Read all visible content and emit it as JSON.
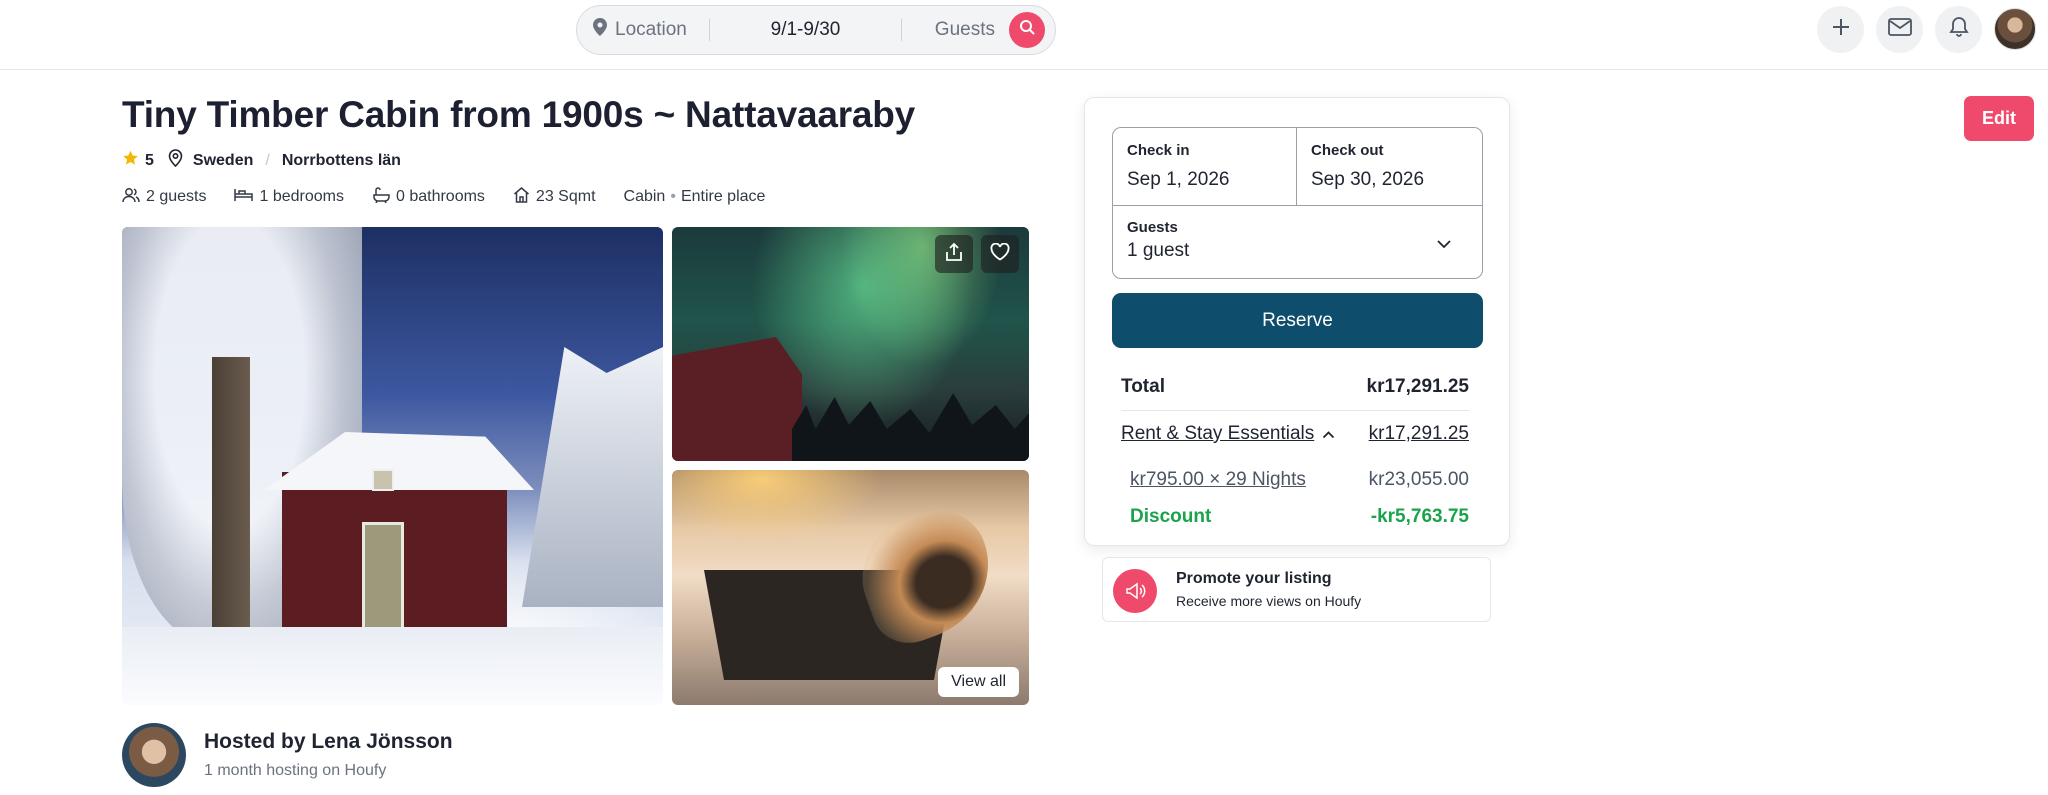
{
  "search": {
    "location_placeholder": "Location",
    "dates": "9/1-9/30",
    "guests_placeholder": "Guests"
  },
  "listing": {
    "title": "Tiny Timber Cabin from 1900s ~ Nattavaaraby",
    "rating": "5",
    "country": "Sweden",
    "region": "Norrbottens län",
    "guests": "2 guests",
    "bedrooms": "1 bedrooms",
    "bathrooms": "0 bathrooms",
    "size": "23 Sqmt",
    "type": "Cabin",
    "place": "Entire place"
  },
  "photos": {
    "view_all_label": "View all"
  },
  "host": {
    "name": "Hosted by Lena Jönsson",
    "subtitle": "1 month hosting on Houfy"
  },
  "booking": {
    "checkin_label": "Check in",
    "checkin_value": "Sep 1, 2026",
    "checkout_label": "Check out",
    "checkout_value": "Sep 30, 2026",
    "guests_label": "Guests",
    "guests_value": "1 guest",
    "reserve_label": "Reserve",
    "total_label": "Total",
    "total_value": "kr17,291.25",
    "essentials_label": "Rent & Stay Essentials",
    "essentials_value": "kr17,291.25",
    "nights_label": "kr795.00 × 29 Nights",
    "nights_value": "kr23,055.00",
    "discount_label": "Discount",
    "discount_value": "-kr5,763.75"
  },
  "promo": {
    "title": "Promote your listing",
    "subtitle": "Receive more views on Houfy"
  },
  "edit_label": "Edit",
  "colors": {
    "brand": "#ef4a6b",
    "reserve": "#0e4d6b",
    "discount": "#1aa34a"
  }
}
